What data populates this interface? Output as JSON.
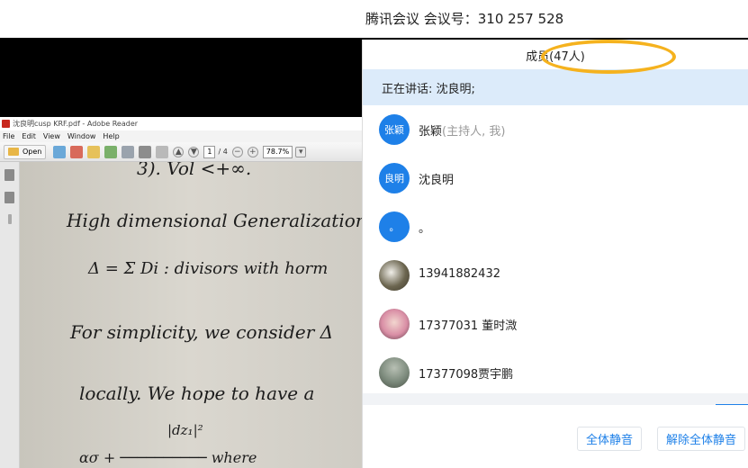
{
  "meeting": {
    "title": "腾讯会议 会议号：310 257 528"
  },
  "reader": {
    "window_title": "沈良明cusp KRF.pdf - Adobe Reader",
    "menu": [
      "File",
      "Edit",
      "View",
      "Window",
      "Help"
    ],
    "open_label": "Open",
    "page_current": "1",
    "page_total": "/ 4",
    "zoom": "78.7%",
    "document_text": [
      "3). Vol <+∞.",
      "High dimensional Generalization: (",
      "Δ = Σ Di :  divisors with  horm",
      "For simplicity, we consider Δ",
      "locally. We hope to have a",
      "|dz₁|²",
      "ασ + ──────────     where"
    ]
  },
  "panel": {
    "title": "成员(47人)",
    "speaking": "正在讲话: 沈良明;",
    "members": [
      {
        "avatar_text": "张颖",
        "name": "张颖",
        "role": "(主持人, 我)",
        "avatar_style": "blue"
      },
      {
        "avatar_text": "良明",
        "name": "沈良明",
        "role": "",
        "avatar_style": "blue"
      },
      {
        "avatar_text": "。",
        "name": "。",
        "role": "",
        "avatar_style": "blue"
      },
      {
        "avatar_text": "",
        "name": "13941882432",
        "role": "",
        "avatar_style": "photo1"
      },
      {
        "avatar_text": "",
        "name": "17377031 董时溦",
        "role": "",
        "avatar_style": "photo2"
      },
      {
        "avatar_text": "",
        "name": "17377098贾宇鹏",
        "role": "",
        "avatar_style": "photo3"
      }
    ],
    "mute_all": "全体静音",
    "unmute_all": "解除全体静音"
  },
  "colors": {
    "accent": "#1e80e8",
    "highlight_ring": "#f5b21e",
    "speaking_bg": "#dcebfa"
  }
}
